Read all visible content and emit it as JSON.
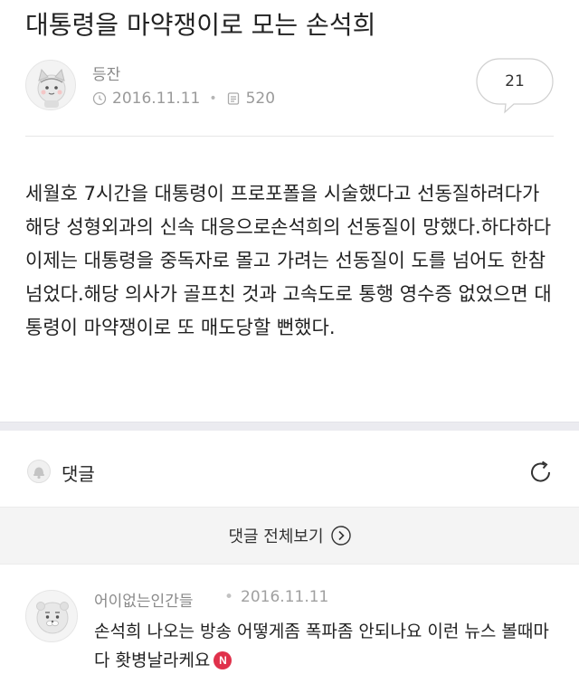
{
  "post": {
    "title": "대통령을 마약쟁이로 모는 손석희",
    "author": "등잔",
    "date": "2016.11.11",
    "views": "520",
    "comment_count": "21",
    "body": "세월호 7시간을 대통령이 프로포폴을 시술했다고 선동질하려다가 해당 성형외과의 신속 대응으로손석희의 선동질이 망했다.하다하다 이제는 대통령을 중독자로 몰고 가려는 선동질이 도를 넘어도 한참 넘었다.해당 의사가 골프친 것과 고속도로 통행 영수증 없었으면 대통령이 마약쟁이로 또 매도당할 뻔했다."
  },
  "comments_section": {
    "label": "댓글",
    "view_all_label": "댓글 전체보기"
  },
  "comments": [
    {
      "author": "어이없는인간들",
      "date": "2016.11.11",
      "text": "손석희 나오는 방송 어떻게좀 폭파좀 안되나요 이런 뉴스 볼때마다 홧병날라케요",
      "badge": "N"
    }
  ],
  "colors": {
    "accent_badge": "#e0314b",
    "muted_text": "#9a9a9a",
    "section_gap": "#ebebf0"
  },
  "icons": {
    "avatar": "cat-avatar-icon",
    "date": "clock-icon",
    "views": "document-icon",
    "bubble": "speech-bubble-icon",
    "bell": "bell-icon",
    "refresh": "refresh-icon",
    "view_all": "chevron-right-circle-icon",
    "comment_avatar": "lion-avatar-icon"
  }
}
